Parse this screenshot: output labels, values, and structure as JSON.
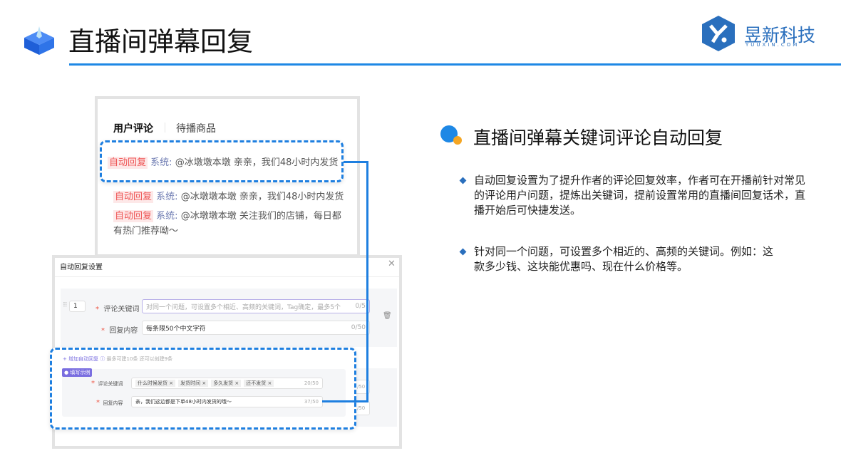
{
  "header": {
    "title": "直播间弹幕回复",
    "logo_name": "昱新科技",
    "logo_domain": "YUUXIN.COM"
  },
  "comments_panel": {
    "tabs": [
      "用户评论",
      "待播商品"
    ],
    "items": [
      {
        "tag": "自动回复",
        "sender": "系统:",
        "text": "@冰墩墩本墩 亲亲，我们48小时内发货"
      },
      {
        "tag": "自动回复",
        "sender": "系统:",
        "text": "@冰墩墩本墩 亲亲，我们48小时内发货"
      },
      {
        "tag": "自动回复",
        "sender": "系统:",
        "text": "@冰墩墩本墩 关注我们的店铺，每日都有热门推荐呦～"
      }
    ]
  },
  "dialog": {
    "title": "自动回复设置",
    "rule": {
      "index": "1",
      "keyword_label": "评论关键词",
      "keyword_placeholder": "对同一个问题，可设置多个相近、高频的关键词，Tag确定，最多5个",
      "keyword_count": "0/5",
      "reply_label": "回复内容",
      "reply_placeholder": "每条限50个中文字符",
      "reply_count": "0/50"
    },
    "add_label": "+ 增加自动回复",
    "add_hint": "最多可建10条 还可以创建9条",
    "example": {
      "badge": "填写示例",
      "keyword_label": "评论关键词",
      "keywords": [
        "什么时候发货",
        "发货时间",
        "多久发货",
        "还不发货"
      ],
      "keyword_count": "20/50",
      "reply_label": "回复内容",
      "reply_value": "亲，我们这边都是下单48小时内发货的哦～",
      "reply_count": "37/50"
    },
    "behind_count": "/50"
  },
  "right": {
    "heading": "直播间弹幕关键词评论自动回复",
    "bullets": [
      "自动回复设置为了提升作者的评论回复效率，作者可在开播前针对常见的评论用户问题，提炼出关键词，提前设置常用的直播间回复话术，直播开始后可快捷发送。",
      "针对同一个问题，可设置多个相近的、高频的关键词。例如：这款多少钱、这块能优惠吗、现在什么价格等。"
    ]
  },
  "colors": {
    "accent": "#1e88e5",
    "tag": "#ee5555"
  }
}
